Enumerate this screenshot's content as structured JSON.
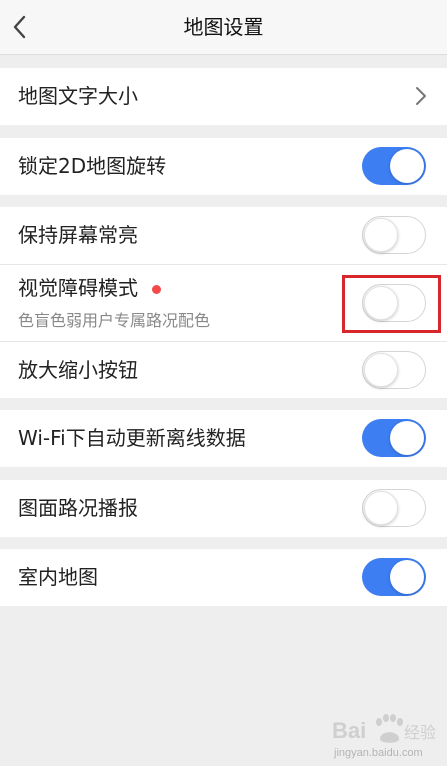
{
  "header": {
    "back_icon": "chevron-left-icon",
    "title": "地图设置"
  },
  "sections": [
    {
      "rows": [
        {
          "label": "地图文字大小",
          "control": "chevron-right-icon"
        }
      ]
    },
    {
      "rows": [
        {
          "label": "锁定2D地图旋转",
          "toggle": "on"
        }
      ]
    },
    {
      "rows": [
        {
          "label": "保持屏幕常亮",
          "toggle": "off"
        },
        {
          "label": "视觉障碍模式",
          "sublabel": "色盲色弱用户专属路况配色",
          "toggle": "off",
          "badge": "red-dot"
        },
        {
          "label": "放大缩小按钮",
          "toggle": "off"
        }
      ]
    },
    {
      "rows": [
        {
          "label": "Wi-Fi下自动更新离线数据",
          "toggle": "on"
        }
      ]
    },
    {
      "rows": [
        {
          "label": "图面路况播报",
          "toggle": "off"
        }
      ]
    },
    {
      "rows": [
        {
          "label": "室内地图",
          "toggle": "on"
        }
      ]
    }
  ],
  "colors": {
    "toggle_on": "#3d7ef2",
    "badge_dot": "#f24a4a",
    "highlight_box": "#d9262c",
    "page_background": "#eeeeee"
  },
  "watermark": {
    "logo_text": "Bai 经验",
    "url": "jingyan.baidu.com"
  }
}
